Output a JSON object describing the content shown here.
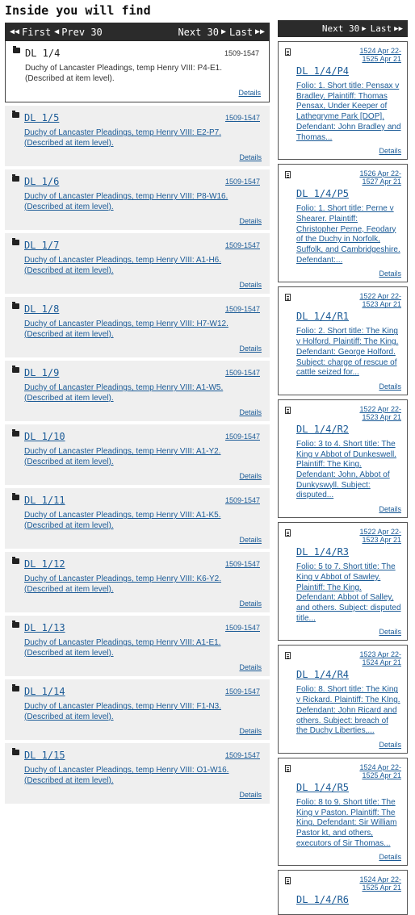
{
  "heading": "Inside you will find",
  "left_nav": {
    "first": "First",
    "prev": "Prev 30",
    "next": "Next 30",
    "last": "Last"
  },
  "current": {
    "ref": "DL 1/4",
    "date": "1509-1547",
    "desc": "Duchy of Lancaster Pleadings, temp Henry VIII: P4-E1. (Described at item level).",
    "details": "Details"
  },
  "items": [
    {
      "ref": "DL 1/5",
      "date": "1509-1547",
      "desc": "Duchy of Lancaster Pleadings, temp Henry VIII: E2-P7. (Described at item level).",
      "details": "Details"
    },
    {
      "ref": "DL 1/6",
      "date": "1509-1547",
      "desc": "Duchy of Lancaster Pleadings, temp Henry VIII: P8-W16. (Described at item level).",
      "details": "Details"
    },
    {
      "ref": "DL 1/7",
      "date": "1509-1547",
      "desc": "Duchy of Lancaster Pleadings, temp Henry VIII: A1-H6. (Described at item level).",
      "details": "Details"
    },
    {
      "ref": "DL 1/8",
      "date": "1509-1547",
      "desc": "Duchy of Lancaster Pleadings, temp Henry VIII: H7-W12. (Described at item level).",
      "details": "Details"
    },
    {
      "ref": "DL 1/9",
      "date": "1509-1547",
      "desc": "Duchy of Lancaster Pleadings, temp Henry VIII: A1-W5. (Described at item level).",
      "details": "Details"
    },
    {
      "ref": "DL 1/10",
      "date": "1509-1547",
      "desc": "Duchy of Lancaster Pleadings, temp Henry VIII: A1-Y2. (Described at item level).",
      "details": "Details"
    },
    {
      "ref": "DL 1/11",
      "date": "1509-1547",
      "desc": "Duchy of Lancaster Pleadings, temp Henry VIII: A1-K5. (Described at item level).",
      "details": "Details"
    },
    {
      "ref": "DL 1/12",
      "date": "1509-1547",
      "desc": "Duchy of Lancaster Pleadings, temp Henry VIII: K6-Y2. (Described at item level).",
      "details": "Details"
    },
    {
      "ref": "DL 1/13",
      "date": "1509-1547",
      "desc": "Duchy of Lancaster Pleadings, temp Henry VIII: A1-E1. (Described at item level).",
      "details": "Details"
    },
    {
      "ref": "DL 1/14",
      "date": "1509-1547",
      "desc": "Duchy of Lancaster Pleadings, temp Henry VIII: F1-N3. (Described at item level).",
      "details": "Details"
    },
    {
      "ref": "DL 1/15",
      "date": "1509-1547",
      "desc": "Duchy of Lancaster Pleadings, temp Henry VIII: O1-W16. (Described at item level).",
      "details": "Details"
    }
  ],
  "right_nav": {
    "next": "Next 30",
    "last": "Last"
  },
  "right_items": [
    {
      "date": "1524 Apr 22-1525 Apr 21",
      "ref": "DL 1/4/P4",
      "desc": "Folio: 1. Short title: Pensax v Bradley. Plaintiff: Thomas Pensax, Under Keeper of Lathegryme Park [DOP]. Defendant: John Bradley and Thomas...",
      "details": "Details"
    },
    {
      "date": "1526 Apr 22-1527 Apr 21",
      "ref": "DL 1/4/P5",
      "desc": "Folio: 1. Short title: Perne v Shearer. Plaintiff: Christopher Perne, Feodary of the Duchy in Norfolk, Suffolk, and Cambridgeshire. Defendant:...",
      "details": "Details"
    },
    {
      "date": "1522 Apr 22-1523 Apr 21",
      "ref": "DL 1/4/R1",
      "desc": "Folio: 2. Short title: The King v Holford. Plaintiff: The King. Defendant: George Holford. Subject: charge of rescue of cattle seized for...",
      "details": "Details"
    },
    {
      "date": "1522 Apr 22-1523 Apr 21",
      "ref": "DL 1/4/R2",
      "desc": "Folio: 3 to 4. Short title: The King v Abbot of Dunkeswell. Plaintiff: The King. Defendant: John, Abbot of Dunkyswyll. Subject: disputed...",
      "details": "Details"
    },
    {
      "date": "1522 Apr 22-1523 Apr 21",
      "ref": "DL 1/4/R3",
      "desc": "Folio: 5 to 7. Short title: The King v Abbot of Sawley. Plaintiff: The King. Defendant: Abbot of Salley, and others. Subject: disputed title...",
      "details": "Details"
    },
    {
      "date": "1523 Apr 22-1524 Apr 21",
      "ref": "DL 1/4/R4",
      "desc": "Folio: 8. Short title: The King v Rickard. Plaintiff: The KIng. Defendant: John Ricard and others. Subject: breach of the Duchy Liberties,...",
      "details": "Details"
    },
    {
      "date": "1524 Apr 22-1525 Apr 21",
      "ref": "DL 1/4/R5",
      "desc": "Folio: 8 to 9. Short title: The King v Paston. Plaintiff: The King. Defendant: Sir William Pastor kt, and others, executors of Sir Thomas...",
      "details": "Details"
    },
    {
      "date": "1524 Apr 22-1525 Apr 21",
      "ref": "DL 1/4/R6",
      "desc": "",
      "details": ""
    }
  ]
}
